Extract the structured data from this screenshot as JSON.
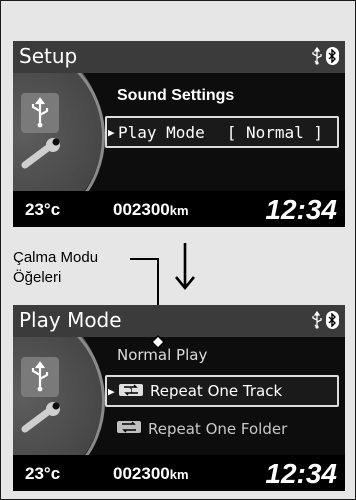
{
  "screens": [
    {
      "title": "Setup",
      "heading": "Sound Settings",
      "items": [
        {
          "label": "Play Mode",
          "value": "[ Normal ]",
          "selected": true
        }
      ],
      "footer": {
        "temperature": "23°c",
        "odometer": "002300",
        "odometer_unit": "km",
        "clock": "12:34"
      }
    },
    {
      "title": "Play Mode",
      "items": [
        {
          "label": "Normal Play",
          "selected": false
        },
        {
          "label": "Repeat One Track",
          "selected": true
        },
        {
          "label": "Repeat One Folder",
          "selected": false
        }
      ],
      "footer": {
        "temperature": "23°c",
        "odometer": "002300",
        "odometer_unit": "km",
        "clock": "12:34"
      }
    }
  ],
  "caption": {
    "line1": "Çalma Modu",
    "line2": "Öğeleri"
  },
  "colors": {
    "header": "#3b3b3b",
    "screen": "#000000",
    "frame_bg": "#e6e6e6",
    "highlight_border": "#dcdcdc"
  },
  "icons": [
    "usb-icon",
    "bluetooth-icon",
    "usb-wrench-icon",
    "repeat-one-icon",
    "repeat-folder-icon",
    "down-arrow-icon"
  ]
}
